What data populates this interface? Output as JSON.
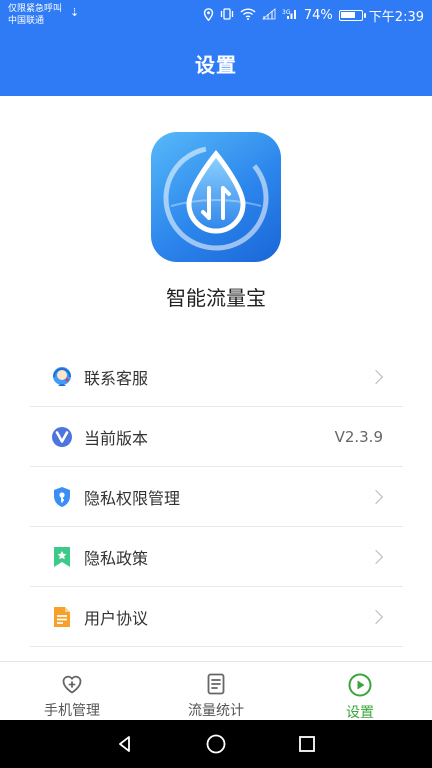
{
  "status_bar": {
    "carrier_line1": "仅限紧急呼叫",
    "carrier_line2": "中国联通",
    "battery_percent": "74%",
    "battery_level": 0.74,
    "time": "下午2:39"
  },
  "header": {
    "title": "设置"
  },
  "app": {
    "name": "智能流量宝"
  },
  "menu": {
    "items": [
      {
        "label": "联系客服",
        "icon": "customer-service-icon",
        "value": ""
      },
      {
        "label": "当前版本",
        "icon": "version-icon",
        "value": "V2.3.9"
      },
      {
        "label": "隐私权限管理",
        "icon": "privacy-permission-icon",
        "value": ""
      },
      {
        "label": "隐私政策",
        "icon": "privacy-policy-icon",
        "value": ""
      },
      {
        "label": "用户协议",
        "icon": "user-agreement-icon",
        "value": ""
      }
    ]
  },
  "bottom_nav": {
    "items": [
      {
        "label": "手机管理",
        "icon": "heart-plus-icon",
        "active": false
      },
      {
        "label": "流量统计",
        "icon": "document-list-icon",
        "active": false
      },
      {
        "label": "设置",
        "icon": "play-circle-icon",
        "active": true
      }
    ]
  },
  "colors": {
    "primary": "#2f7bf6",
    "active_tab": "#3aa53a"
  }
}
